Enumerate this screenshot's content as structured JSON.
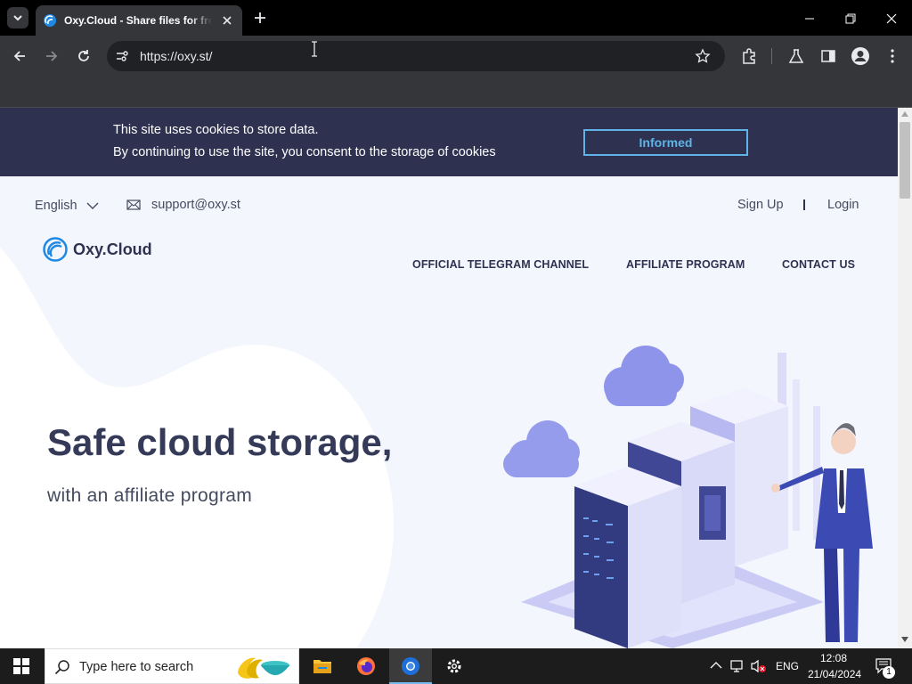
{
  "browser": {
    "tab_title": "Oxy.Cloud - Share files for free",
    "url": "https://oxy.st/"
  },
  "cookie_banner": {
    "line1": "This site uses cookies to store data.",
    "line2": "By continuing to use the site, you consent to the storage of cookies",
    "button": "Informed"
  },
  "header": {
    "language": "English",
    "email": "support@oxy.st",
    "sign_up": "Sign Up",
    "login": "Login",
    "brand": "Oxy.Cloud"
  },
  "menu": {
    "items": [
      "OFFICIAL TELEGRAM CHANNEL",
      "AFFILIATE PROGRAM",
      "CONTACT US"
    ]
  },
  "hero": {
    "title": "Safe cloud storage,",
    "subtitle": "with an affiliate program"
  },
  "taskbar": {
    "search_placeholder": "Type here to search",
    "language": "ENG",
    "time": "12:08",
    "date": "21/04/2024",
    "notification_count": "1"
  },
  "colors": {
    "banner": "#2e3250",
    "accent": "#5fb3e6",
    "brand_blue": "#1e88e5",
    "page_bg": "#f4f6fe"
  }
}
